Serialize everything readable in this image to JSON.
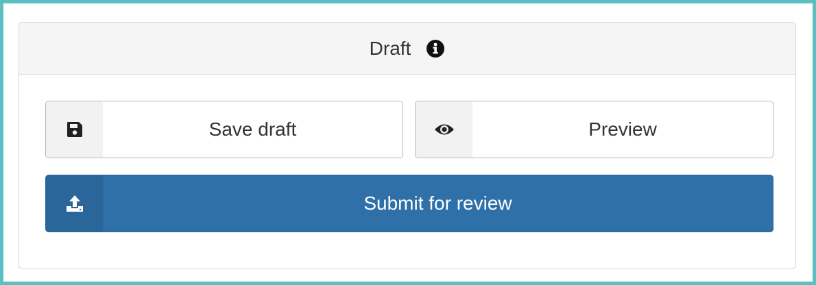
{
  "panel": {
    "title": "Draft",
    "info_icon": "info-circle-icon"
  },
  "buttons": {
    "save": {
      "label": "Save draft",
      "icon": "floppy-disk-icon"
    },
    "preview": {
      "label": "Preview",
      "icon": "eye-icon"
    },
    "submit": {
      "label": "Submit for review",
      "icon": "upload-icon"
    }
  },
  "colors": {
    "frame_border": "#5bbfc4",
    "primary": "#2f70a8",
    "heading_bg": "#f5f5f5"
  }
}
